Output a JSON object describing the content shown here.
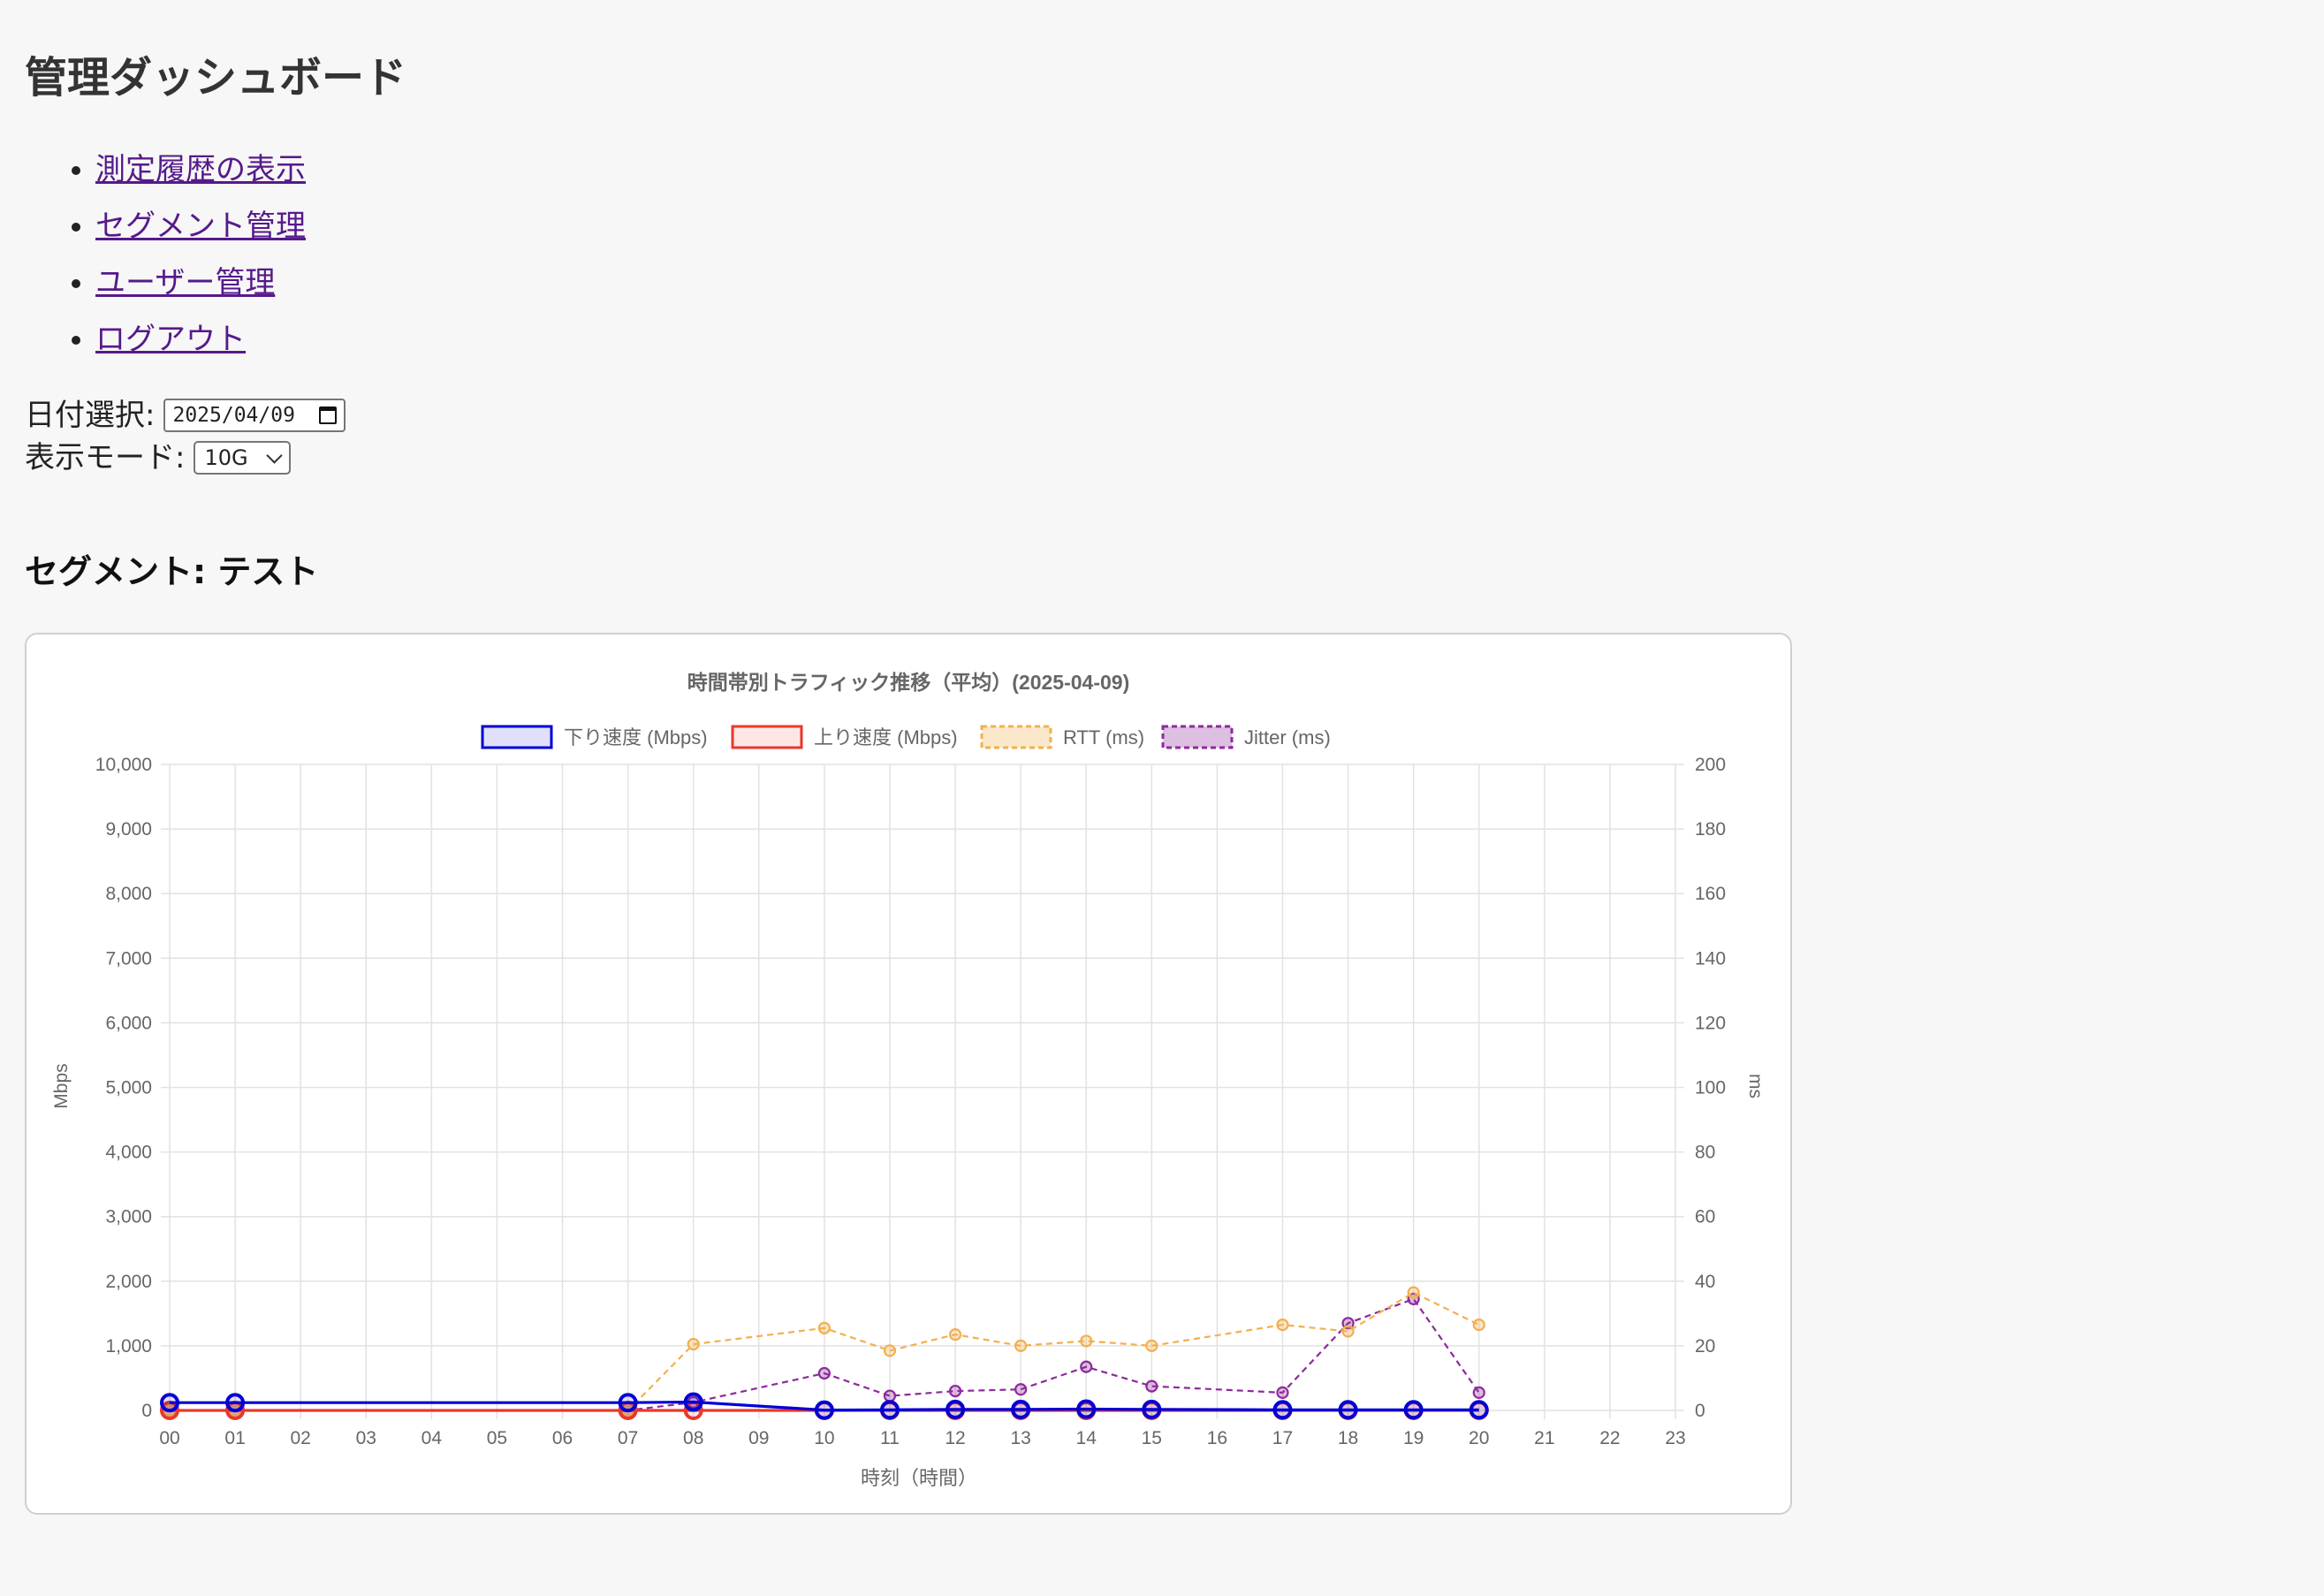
{
  "page_title": "管理ダッシュボード",
  "nav": [
    {
      "label": "測定履歴の表示"
    },
    {
      "label": "セグメント管理"
    },
    {
      "label": "ユーザー管理"
    },
    {
      "label": "ログアウト"
    }
  ],
  "controls": {
    "date_label": "日付選択:",
    "date_value": "2025/04/09",
    "mode_label": "表示モード:",
    "mode_value": "10G"
  },
  "segment_heading": "セグメント: テスト",
  "colors": {
    "download": "#0000d6",
    "upload": "#e8382c",
    "rtt": "#f2b04f",
    "jitter": "#8e2a9c"
  },
  "chart_data": {
    "type": "line",
    "title": "時間帯別トラフィック推移（平均）(2025-04-09)",
    "xlabel": "時刻（時間）",
    "ylabel_left": "Mbps",
    "ylabel_right": "ms",
    "ylim_left": [
      0,
      10000
    ],
    "ylim_right": [
      0,
      200
    ],
    "yticks_left": [
      "0",
      "1,000",
      "2,000",
      "3,000",
      "4,000",
      "5,000",
      "6,000",
      "7,000",
      "8,000",
      "9,000",
      "10,000"
    ],
    "yticks_right": [
      "0",
      "20",
      "40",
      "60",
      "80",
      "100",
      "120",
      "140",
      "160",
      "180",
      "200"
    ],
    "categories": [
      "00",
      "01",
      "02",
      "03",
      "04",
      "05",
      "06",
      "07",
      "08",
      "09",
      "10",
      "11",
      "12",
      "13",
      "14",
      "15",
      "16",
      "17",
      "18",
      "19",
      "20",
      "21",
      "22",
      "23"
    ],
    "grid": true,
    "legend_position": "top",
    "series": [
      {
        "name": "下り速度 (Mbps)",
        "axis": "left",
        "style": "solid",
        "values": [
          120,
          120,
          null,
          null,
          null,
          null,
          null,
          120,
          130,
          null,
          5,
          10,
          15,
          15,
          20,
          15,
          null,
          10,
          10,
          10,
          10,
          null,
          null,
          null
        ]
      },
      {
        "name": "上り速度 (Mbps)",
        "axis": "left",
        "style": "solid",
        "values": [
          0,
          0,
          null,
          null,
          null,
          null,
          null,
          0,
          0,
          null,
          0,
          0,
          0,
          0,
          0,
          0,
          null,
          0,
          0,
          0,
          0,
          null,
          null,
          null
        ]
      },
      {
        "name": "RTT (ms)",
        "axis": "right",
        "style": "dashed",
        "values": [
          0,
          0,
          null,
          null,
          null,
          null,
          null,
          0,
          20.5,
          null,
          25.5,
          18.5,
          23.5,
          20,
          21.5,
          20,
          null,
          26.5,
          24.5,
          36.5,
          26.5,
          null,
          null,
          null
        ]
      },
      {
        "name": "Jitter (ms)",
        "axis": "right",
        "style": "dashed",
        "values": [
          0,
          0,
          null,
          null,
          null,
          null,
          null,
          0,
          2.5,
          null,
          11.5,
          4.5,
          6,
          6.5,
          13.5,
          7.5,
          null,
          5.5,
          27,
          34.5,
          5.5,
          null,
          null,
          null
        ]
      }
    ]
  }
}
